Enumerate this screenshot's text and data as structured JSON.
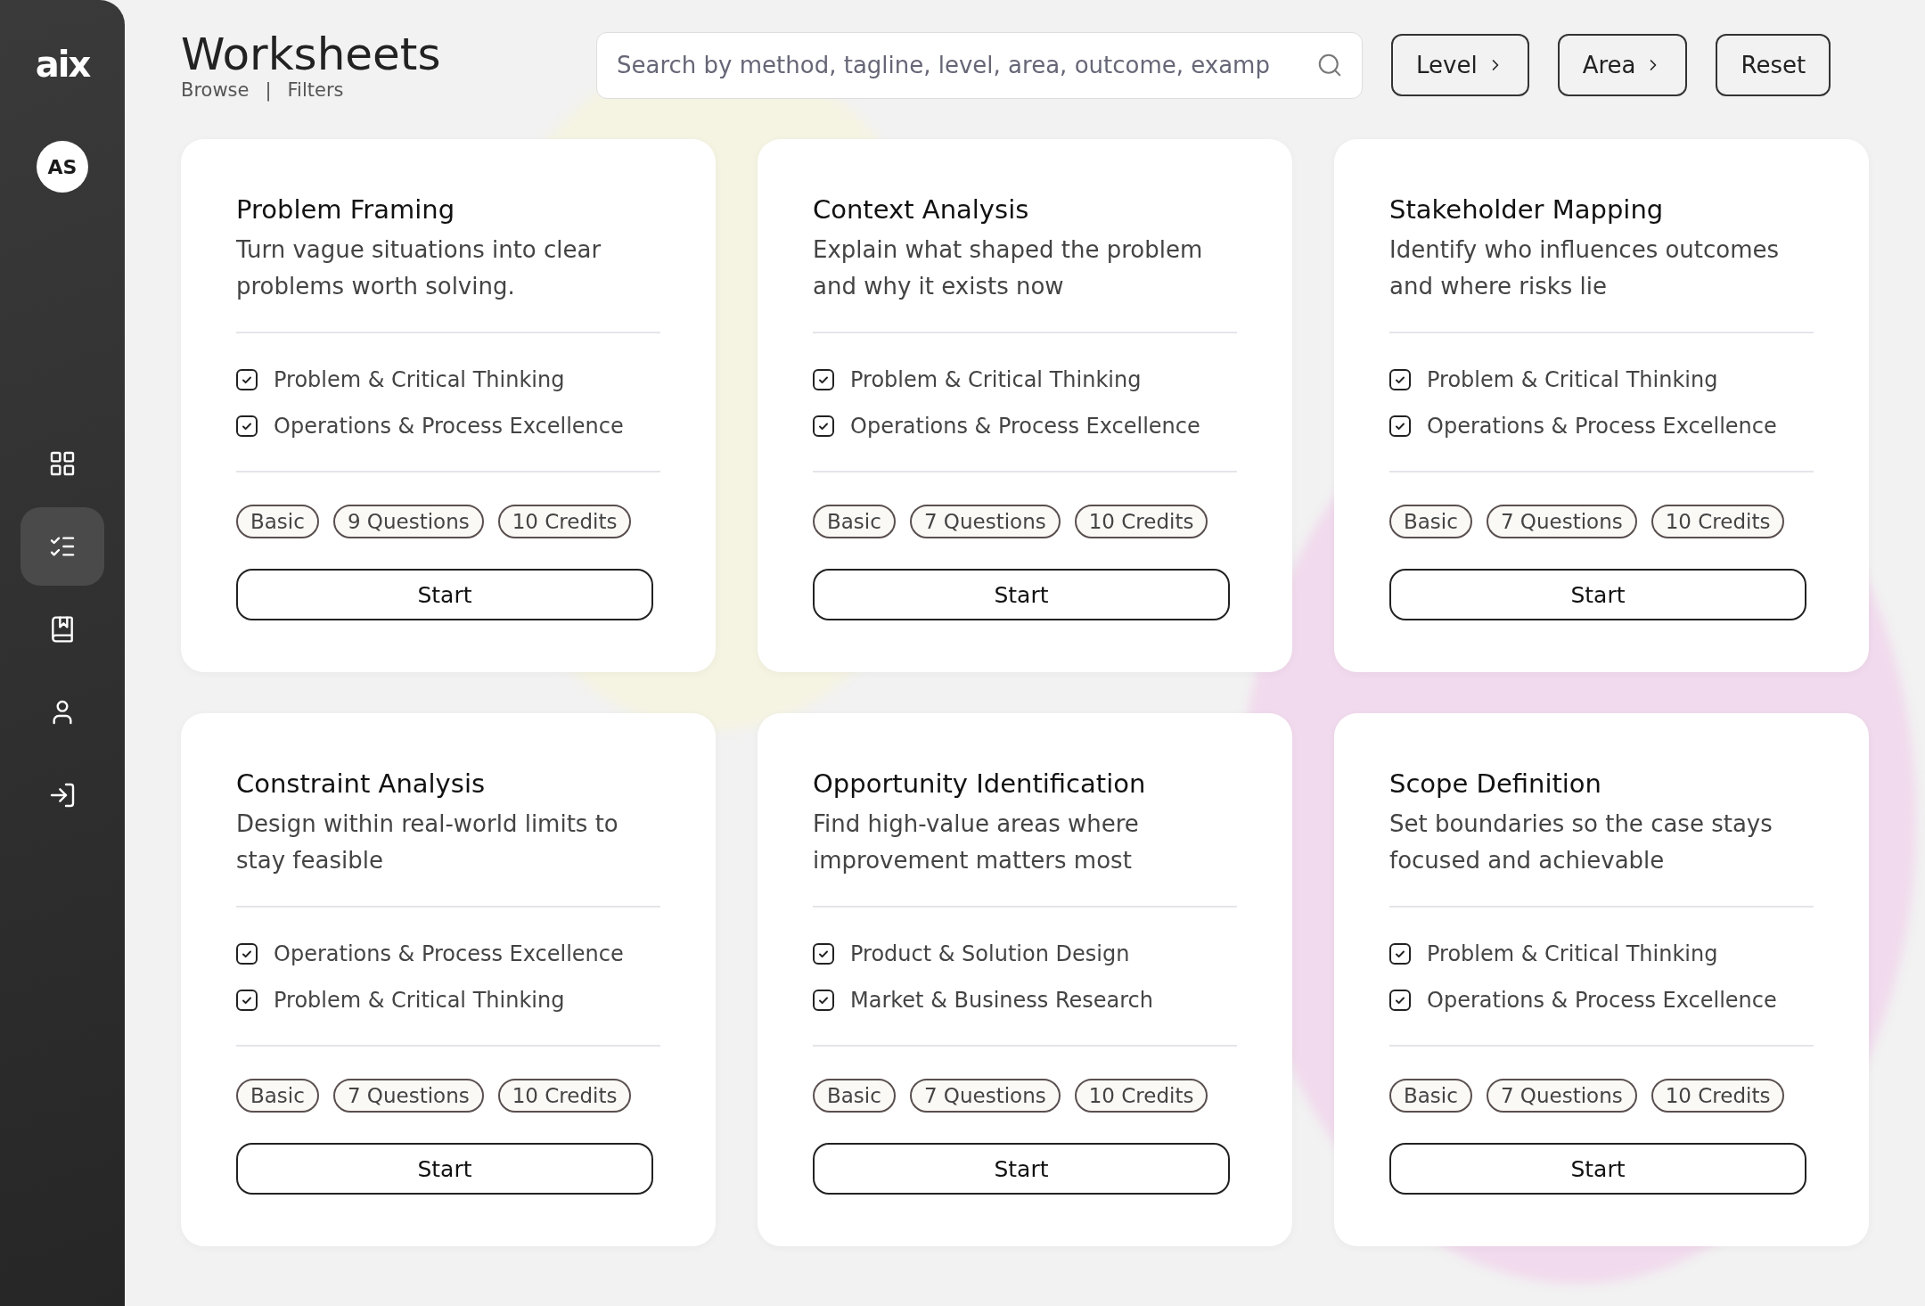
{
  "sidebar": {
    "logo": "aix",
    "avatar": "AS",
    "items": [
      {
        "kind": "grid",
        "selected": false
      },
      {
        "kind": "checklist",
        "selected": true
      },
      {
        "kind": "bookmark",
        "selected": false
      },
      {
        "kind": "user",
        "selected": false
      },
      {
        "kind": "logout",
        "selected": false
      }
    ]
  },
  "header": {
    "title": "Worksheets",
    "breadcrumb": [
      "Browse",
      "Filters"
    ],
    "separator": "|",
    "search": {
      "placeholder": "Search by method, tagline, level, area, outcome, examp"
    },
    "filters": [
      {
        "label": "Level",
        "kind": "menu"
      },
      {
        "label": "Area",
        "kind": "menu"
      },
      {
        "label": "Reset",
        "kind": "plain"
      }
    ]
  },
  "cards": [
    {
      "title": "Problem Framing",
      "description": "Turn vague situations into clear problems worth solving.",
      "areas": [
        {
          "label": "Problem & Critical Thinking",
          "checked": true
        },
        {
          "label": "Operations & Process Excellence",
          "checked": true
        }
      ],
      "tags": [
        "Basic",
        "9 Questions",
        "10 Credits"
      ],
      "action": "Start"
    },
    {
      "title": "Context Analysis",
      "description": "Explain what shaped the problem and why it exists now",
      "areas": [
        {
          "label": "Problem & Critical Thinking",
          "checked": true
        },
        {
          "label": "Operations & Process Excellence",
          "checked": true
        }
      ],
      "tags": [
        "Basic",
        "7 Questions",
        "10 Credits"
      ],
      "action": "Start"
    },
    {
      "title": "Stakeholder Mapping",
      "description": "Identify who influences outcomes and where risks lie",
      "areas": [
        {
          "label": "Problem & Critical Thinking",
          "checked": true
        },
        {
          "label": "Operations & Process Excellence",
          "checked": true
        }
      ],
      "tags": [
        "Basic",
        "7 Questions",
        "10 Credits"
      ],
      "action": "Start"
    },
    {
      "title": "Constraint Analysis",
      "description": "Design within real-world limits to stay feasible",
      "areas": [
        {
          "label": "Operations & Process Excellence",
          "checked": true
        },
        {
          "label": "Problem & Critical Thinking",
          "checked": true
        }
      ],
      "tags": [
        "Basic",
        "7 Questions",
        "10 Credits"
      ],
      "action": "Start"
    },
    {
      "title": "Opportunity Identification",
      "description": "Find high-value areas where improvement matters most",
      "areas": [
        {
          "label": "Product & Solution Design",
          "checked": true
        },
        {
          "label": "Market & Business Research",
          "checked": true
        }
      ],
      "tags": [
        "Basic",
        "7 Questions",
        "10 Credits"
      ],
      "action": "Start"
    },
    {
      "title": "Scope Definition",
      "description": "Set boundaries so the case stays focused and achievable",
      "areas": [
        {
          "label": "Problem & Critical Thinking",
          "checked": true
        },
        {
          "label": "Operations & Process Excellence",
          "checked": true
        }
      ],
      "tags": [
        "Basic",
        "7 Questions",
        "10 Credits"
      ],
      "action": "Start"
    }
  ]
}
